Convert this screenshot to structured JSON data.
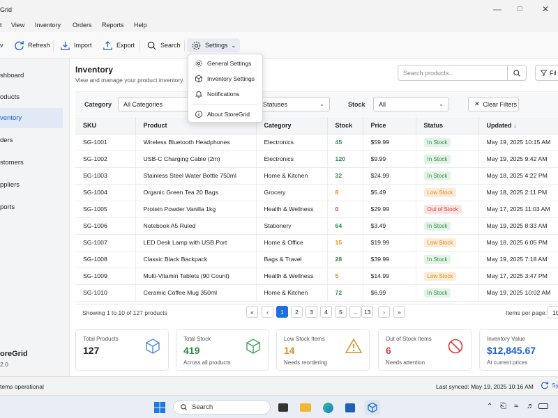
{
  "window": {
    "title": "Grid"
  },
  "menu": [
    "t",
    "View",
    "Inventory",
    "Orders",
    "Reports",
    "Help"
  ],
  "toolbar": {
    "new_label": "v",
    "refresh_label": "Refresh",
    "import_label": "Import",
    "export_label": "Export",
    "search_label": "Search",
    "settings_label": "Settings"
  },
  "settings_menu": {
    "general": "General Settings",
    "inventory": "Inventory Settings",
    "notifications": "Notifications",
    "about": "About StoreGrid"
  },
  "sidebar": {
    "items": [
      {
        "label": "shboard",
        "active": false
      },
      {
        "label": "oducts",
        "active": false
      },
      {
        "label": "ventory",
        "active": true
      },
      {
        "label": "ders",
        "active": false
      },
      {
        "label": "stomers",
        "active": false
      },
      {
        "label": "ppliers",
        "active": false
      },
      {
        "label": "ports",
        "active": false
      }
    ],
    "brand": "oreGrid",
    "version": "2.0"
  },
  "page": {
    "title": "Inventory",
    "subtitle": "View and manage your product inventory.",
    "search_placeholder": "Search products...",
    "filter_label": "Fil"
  },
  "filters": {
    "category_label": "Category",
    "category_value": "All Categories",
    "status_value": "Statuses",
    "stock_label": "Stock",
    "stock_value": "All",
    "clear_label": "Clear Filters"
  },
  "table": {
    "headers": [
      "SKU",
      "Product",
      "Category",
      "Stock",
      "Price",
      "Status",
      "Updated"
    ],
    "sort_arrow": "↓",
    "rows": [
      {
        "sku": "SG-1001",
        "product": "Wireless Bluetooth Headphones",
        "category": "Electronics",
        "stock": "45",
        "price": "$59.99",
        "status": "In Stock",
        "updated": "May 19, 2025 10:15 AM"
      },
      {
        "sku": "SG-1002",
        "product": "USB-C Charging Cable (2m)",
        "category": "Electronics",
        "stock": "120",
        "price": "$9.99",
        "status": "In Stock",
        "updated": "May 19, 2025 9:42 AM"
      },
      {
        "sku": "SG-1003",
        "product": "Stainless Steel Water Bottle 750ml",
        "category": "Home & Kitchen",
        "stock": "32",
        "price": "$24.99",
        "status": "In Stock",
        "updated": "May 18, 2025 4:22 PM"
      },
      {
        "sku": "SG-1004",
        "product": "Organic Green Tea 20 Bags",
        "category": "Grocery",
        "stock": "8",
        "price": "$5.49",
        "status": "Low Stock",
        "updated": "May 18, 2025 2:11 PM"
      },
      {
        "sku": "SG-1005",
        "product": "Protein Powder Vanilla 1kg",
        "category": "Health & Wellness",
        "stock": "0",
        "price": "$29.99",
        "status": "Out of Stock",
        "updated": "May 17, 2025 11:03 AM"
      },
      {
        "sku": "SG-1006",
        "product": "Notebook A5 Ruled",
        "category": "Stationery",
        "stock": "64",
        "price": "$3.49",
        "status": "In Stock",
        "updated": "May 19, 2025 8:33 AM"
      },
      {
        "sku": "SG-1007",
        "product": "LED Desk Lamp with USB Port",
        "category": "Home & Office",
        "stock": "15",
        "price": "$19.99",
        "status": "Low Stock",
        "updated": "May 18, 2025 6:05 PM"
      },
      {
        "sku": "SG-1008",
        "product": "Classic Black Backpack",
        "category": "Bags & Travel",
        "stock": "28",
        "price": "$39.99",
        "status": "In Stock",
        "updated": "May 19, 2025 7:18 AM"
      },
      {
        "sku": "SG-1009",
        "product": "Multi-Vitamin Tablets (90 Count)",
        "category": "Health & Wellness",
        "stock": "5",
        "price": "$14.99",
        "status": "Low Stock",
        "updated": "May 17, 2025 3:47 PM"
      },
      {
        "sku": "SG-1010",
        "product": "Ceramic Coffee Mug 350ml",
        "category": "Home & Kitchen",
        "stock": "72",
        "price": "$6.99",
        "status": "In Stock",
        "updated": "May 19, 2025 10:02 AM"
      }
    ]
  },
  "pagination": {
    "info": "Showing 1 to 10 of 127 products",
    "pages": [
      "«",
      "‹",
      "1",
      "2",
      "3",
      "4",
      "5",
      "...",
      "13",
      "›",
      "»"
    ],
    "items_per_page_label": "Items per page:",
    "items_per_page_value": "10"
  },
  "cards": [
    {
      "label": "Total Products",
      "value": "127",
      "note": ""
    },
    {
      "label": "Total Stock",
      "value": "419",
      "note": "Across all products"
    },
    {
      "label": "Low Stock Items",
      "value": "14",
      "note": "Needs reordering"
    },
    {
      "label": "Out of Stock Items",
      "value": "6",
      "note": "Needs attention"
    },
    {
      "label": "Inventory Value",
      "value": "$12,845.67",
      "note": "At current prices"
    }
  ],
  "status_bar": {
    "left": "tems operational",
    "last_synced": "Last synced: May 19, 2025 10:16 AM",
    "sync_label": "Sy"
  },
  "taskbar": {
    "search_label": "Search"
  },
  "colors": {
    "accent": "#1c6fe0",
    "in_stock_bg": "#e3f4e6",
    "in_stock_fg": "#2e8b45",
    "low_stock_bg": "#fdebd7",
    "low_stock_fg": "#e08a1e",
    "out_stock_bg": "#fde2e2",
    "out_stock_fg": "#d63a3a"
  }
}
